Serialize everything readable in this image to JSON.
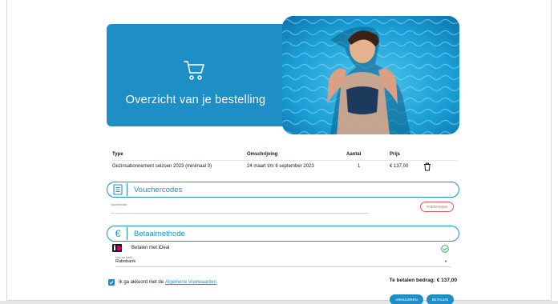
{
  "hero": {
    "title": "Overzicht van je bestelling",
    "icon": "shopping-cart-icon",
    "image": "swimmer-in-pool-photo"
  },
  "order_table": {
    "columns": [
      "Type",
      "Omschrijving",
      "Aantal",
      "Prijs"
    ],
    "rows": [
      {
        "type": "Gezinsabonnement seizoen 2023 (minimaal 3)",
        "description": "24 maart t/m 8 september 2023",
        "quantity": "1",
        "price": "€ 137,00",
        "action_icon": "trash-icon"
      }
    ]
  },
  "voucher": {
    "section_title": "Vouchercodes",
    "icon": "voucher-list-icon",
    "field_label": "Vouchercode",
    "apply_label": "TOEPASSEN"
  },
  "payment": {
    "section_title": "Betaalmethode",
    "icon": "euro-icon",
    "method_label": "Betalen met iDeal",
    "method_icon": "ideal-icon",
    "status_icon": "check-circle-icon",
    "bank_field_label": "Kies uw bank",
    "bank_value": "Rabobank"
  },
  "agreement": {
    "text": "Ik ga akkoord met de",
    "link_text": "Algemene Voorwaarden",
    "checked": true
  },
  "total": {
    "text": "Te betalen bedrag: € 137,00"
  },
  "actions": {
    "cancel_label": "ANNULEREN",
    "pay_label": "BETALEN"
  },
  "colors": {
    "brand_blue": "#1e8ec6",
    "danger": "#e05a5a"
  }
}
